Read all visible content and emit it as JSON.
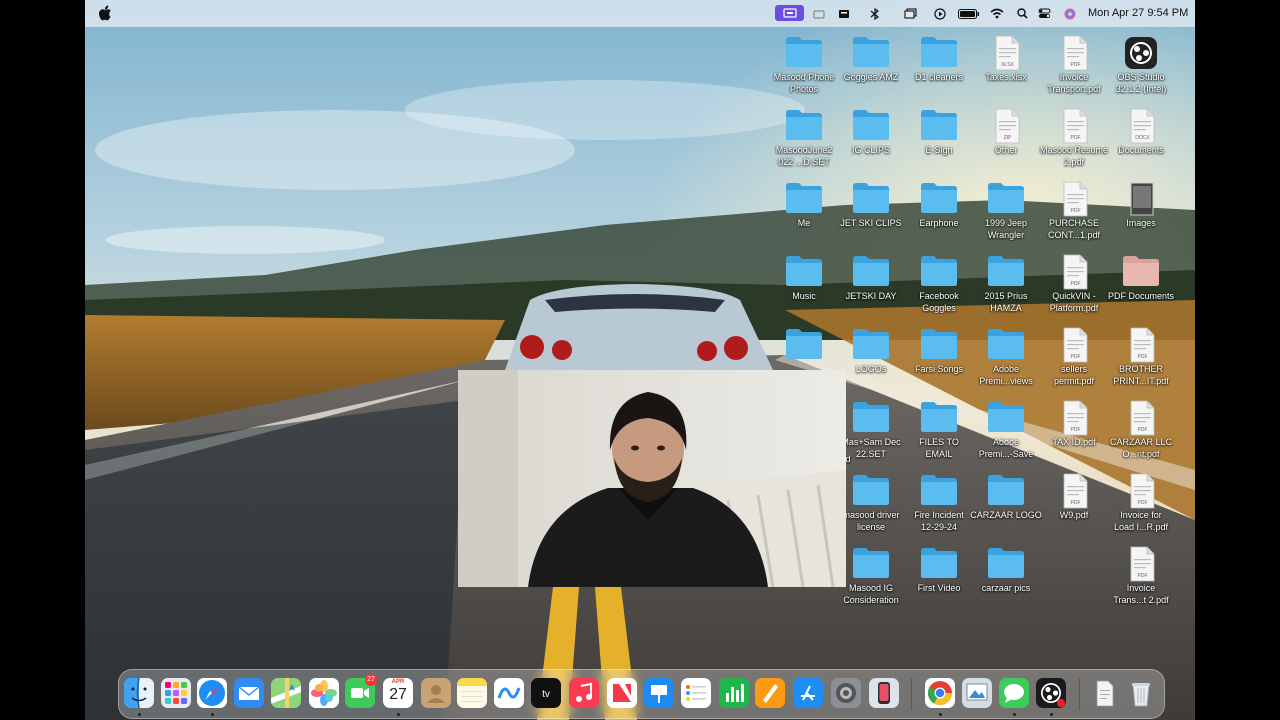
{
  "menubar": {
    "clock": "Mon Apr 27  9:54 PM",
    "icons": [
      "screen-recorder-icon",
      "camera-off-icon",
      "camera-icon",
      "bluetooth-icon",
      "window-icon",
      "play-icon",
      "battery-icon",
      "wifi-icon",
      "search-icon",
      "control-center-icon",
      "siri-icon"
    ]
  },
  "desktop": {
    "items": [
      {
        "name": "desktop-folder-masood-phone-photos",
        "label": "Masood Phone Photos",
        "type": "folder"
      },
      {
        "name": "desktop-folder-goggles-amz",
        "label": "Goggles AMZ",
        "type": "folder"
      },
      {
        "name": "desktop-folder-d1-cleaners",
        "label": "D1 cleaners",
        "type": "folder"
      },
      {
        "name": "desktop-file-taxes",
        "label": "Taxes.xlsx",
        "type": "xlsx"
      },
      {
        "name": "desktop-file-invoice-transport",
        "label": "Invoice Transport.pdf",
        "type": "pdf"
      },
      {
        "name": "desktop-app-obs",
        "label": "OBS Studio 32.1.2 (Intel)",
        "type": "obs"
      },
      {
        "name": "desktop-folder-masoodjune",
        "label": "MasoodJune2 022 ...D.SET",
        "type": "folder"
      },
      {
        "name": "desktop-folder-ig-clips",
        "label": "IG CLIPS",
        "type": "folder"
      },
      {
        "name": "desktop-folder-e-sign",
        "label": "E-Sign",
        "type": "folder"
      },
      {
        "name": "desktop-file-other",
        "label": "Other",
        "type": "zip"
      },
      {
        "name": "desktop-file-masood-resume",
        "label": "Masood Resume 2.pdf",
        "type": "pdf"
      },
      {
        "name": "desktop-file-documents",
        "label": "Documents",
        "type": "doc"
      },
      {
        "name": "desktop-folder-me",
        "label": "Me",
        "type": "folder"
      },
      {
        "name": "desktop-folder-jet-ski-clips",
        "label": "JET SKI CLIPS",
        "type": "folder"
      },
      {
        "name": "desktop-folder-earphone",
        "label": "Earphone",
        "type": "folder"
      },
      {
        "name": "desktop-folder-1999-jeep",
        "label": "1999 Jeep Wrangler",
        "type": "folder"
      },
      {
        "name": "desktop-file-purchase-cont",
        "label": "PURCHASE CONT...1.pdf",
        "type": "pdf"
      },
      {
        "name": "desktop-file-images",
        "label": "Images",
        "type": "img"
      },
      {
        "name": "desktop-folder-music",
        "label": "Music",
        "type": "folder"
      },
      {
        "name": "desktop-folder-jetski-day",
        "label": "JETSKI DAY",
        "type": "folder"
      },
      {
        "name": "desktop-folder-facebook-goggles",
        "label": "Facebook Goggles",
        "type": "folder"
      },
      {
        "name": "desktop-folder-2015-prius",
        "label": "2015 Prius HAMZA",
        "type": "folder"
      },
      {
        "name": "desktop-file-quickvin",
        "label": "QuickVIN - Platform.pdf",
        "type": "pdf"
      },
      {
        "name": "desktop-folder-pdf-documents",
        "label": "PDF Documents",
        "type": "pinkfolder"
      },
      {
        "name": "desktop-folder-unnamed",
        "label": "",
        "type": "folder"
      },
      {
        "name": "desktop-folder-logos",
        "label": "LOGOs",
        "type": "folder"
      },
      {
        "name": "desktop-folder-farsi-songs",
        "label": "Farsi Songs",
        "type": "folder"
      },
      {
        "name": "desktop-folder-adobe-premi-views",
        "label": "Adobe Premi...views",
        "type": "folder"
      },
      {
        "name": "desktop-file-sellers-permit",
        "label": "sellers permit.pdf",
        "type": "pdf"
      },
      {
        "name": "desktop-file-brother-print",
        "label": "BROTHER PRINT...IT.pdf",
        "type": "pdf"
      },
      {
        "name": "desktop-folder-mas-sam",
        "label": "Mas+Sam Dec 22.SET",
        "type": "folder"
      },
      {
        "name": "desktop-folder-files-to-email",
        "label": "FILES TO EMAIL",
        "type": "folder"
      },
      {
        "name": "desktop-folder-adobe-premi-save",
        "label": "Adobe Premi...-Save",
        "type": "folder"
      },
      {
        "name": "desktop-file-tax-id",
        "label": "TAX ID.pdf",
        "type": "pdf"
      },
      {
        "name": "desktop-file-carzaar-llc",
        "label": "CARZAAR LLC O...nt.pdf",
        "type": "pdf"
      },
      {
        "name": "desktop-folder-masood-driver-license",
        "label": "masood driver license",
        "type": "folder"
      },
      {
        "name": "desktop-folder-fire-incident",
        "label": "Fire Incident 12-29-24",
        "type": "folder"
      },
      {
        "name": "desktop-folder-carzaar-logo",
        "label": "CARZAAR LOGO",
        "type": "folder"
      },
      {
        "name": "desktop-file-w9",
        "label": "W9.pdf",
        "type": "pdf"
      },
      {
        "name": "desktop-file-invoice-load",
        "label": "Invoice for Load I...R.pdf",
        "type": "pdf"
      },
      {
        "name": "desktop-folder-masood-ig",
        "label": "Masood IG Consideration",
        "type": "folder"
      },
      {
        "name": "desktop-folder-first-video",
        "label": "First Video",
        "type": "folder"
      },
      {
        "name": "desktop-folder-carzaar-pics",
        "label": "carzaar pics",
        "type": "folder"
      },
      {
        "name": "desktop-file-invoice-trans-2",
        "label": "Invoice Trans...t 2.pdf",
        "type": "pdf"
      }
    ],
    "partial_label": "d"
  },
  "dock": {
    "calendar_month": "APR",
    "calendar_day": "27",
    "facetime_badge": "27",
    "apps": [
      "finder",
      "launchpad",
      "safari",
      "mail",
      "maps",
      "photos",
      "facetime",
      "calendar",
      "contacts",
      "notes",
      "freeform",
      "tv",
      "music",
      "news",
      "keynote",
      "reminders",
      "numbers",
      "pages",
      "app-store",
      "system-settings",
      "iphone-mirroring",
      "chrome",
      "preview",
      "messages",
      "obs",
      "documents",
      "trash"
    ]
  },
  "colors": {
    "folder": "#5bbcf0",
    "folder_dark": "#3aa3df",
    "menubar_highlight": "#6b4fe0"
  }
}
